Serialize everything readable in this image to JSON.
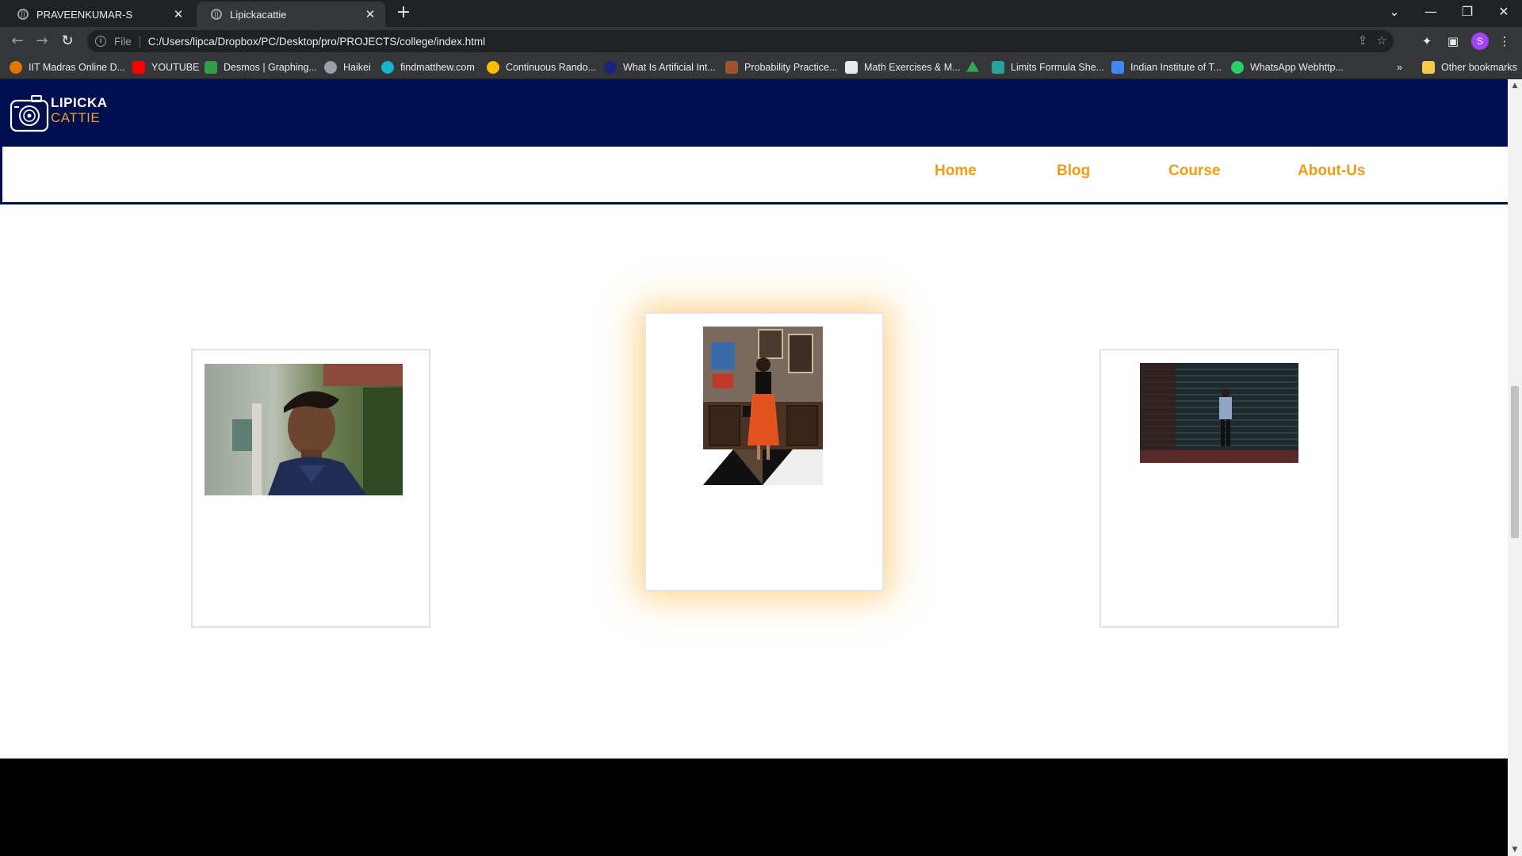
{
  "browser": {
    "tabs": [
      {
        "title": "PRAVEENKUMAR-S",
        "active": false
      },
      {
        "title": "Lipickacattie",
        "active": true
      }
    ],
    "address": {
      "scheme_label": "File",
      "url": "C:/Users/lipca/Dropbox/PC/Desktop/pro/PROJECTS/college/index.html"
    },
    "profile_initial": "S",
    "bookmarks": [
      {
        "label": "IIT Madras Online D...",
        "color": "#e37400"
      },
      {
        "label": "YOUTUBE",
        "color": "#ff0000"
      },
      {
        "label": "Desmos | Graphing...",
        "color": "#2f9e44"
      },
      {
        "label": "Haikei",
        "color": "#9aa0a6"
      },
      {
        "label": "findmatthew.com",
        "color": "#12b5cb"
      },
      {
        "label": "Continuous Rando...",
        "color": "#fbbc04"
      },
      {
        "label": "What Is Artificial Int...",
        "color": "#1a237e"
      },
      {
        "label": "Probability Practice...",
        "color": "#a0522d"
      },
      {
        "label": "Math Exercises & M...",
        "color": "#e8eaed"
      },
      {
        "label": "",
        "color": "#34a853"
      },
      {
        "label": "Limits Formula She...",
        "color": "#26a69a"
      },
      {
        "label": "Indian Institute of T...",
        "color": "#4285f4"
      },
      {
        "label": "WhatsApp Webhttp...",
        "color": "#25d366"
      }
    ],
    "other_bookmarks": "Other bookmarks"
  },
  "site": {
    "logo": {
      "line1": "LIPICKA",
      "line2": "CATTIE",
      "colors": {
        "primary": "#ffffff",
        "accent": "#f0a020"
      }
    },
    "header_color": "#000f4f",
    "nav": [
      {
        "label": "Home"
      },
      {
        "label": "Blog"
      },
      {
        "label": "Course"
      },
      {
        "label": "About-Us"
      }
    ],
    "nav_color": "#f39c12",
    "cards": [
      {
        "image": "portrait of young man in navy jacket",
        "highlighted": false
      },
      {
        "image": "woman in orange skirt in cafe",
        "highlighted": true
      },
      {
        "image": "person standing against dark shutter",
        "highlighted": false
      }
    ]
  }
}
